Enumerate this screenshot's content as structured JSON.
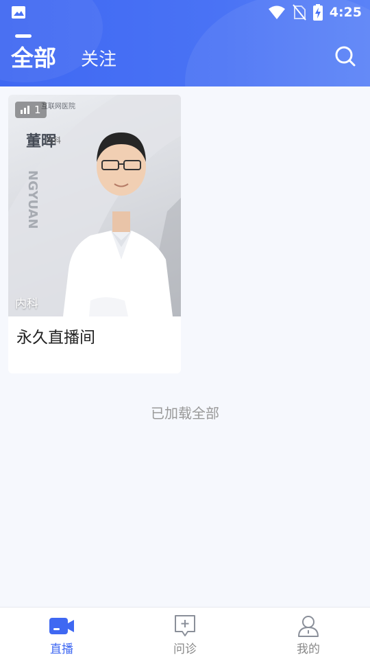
{
  "statusbar": {
    "time": "4:25"
  },
  "tabs": [
    {
      "label": "全部",
      "active": true
    },
    {
      "label": "关注",
      "active": false
    }
  ],
  "card": {
    "viewers": "1",
    "tag": "内科",
    "title": "永久直播间",
    "poster": {
      "hospital": "互联网医院",
      "name": "董晖",
      "dept": "内科",
      "watermark": "NGYUAN"
    }
  },
  "footer_text": "已加载全部",
  "bottom_nav": [
    {
      "label": "直播",
      "icon": "video-camera-icon",
      "active": true
    },
    {
      "label": "问诊",
      "icon": "chat-plus-icon",
      "active": false
    },
    {
      "label": "我的",
      "icon": "user-icon",
      "active": false
    }
  ],
  "colors": {
    "accent": "#3f68f2",
    "background": "#f6f8fd"
  }
}
